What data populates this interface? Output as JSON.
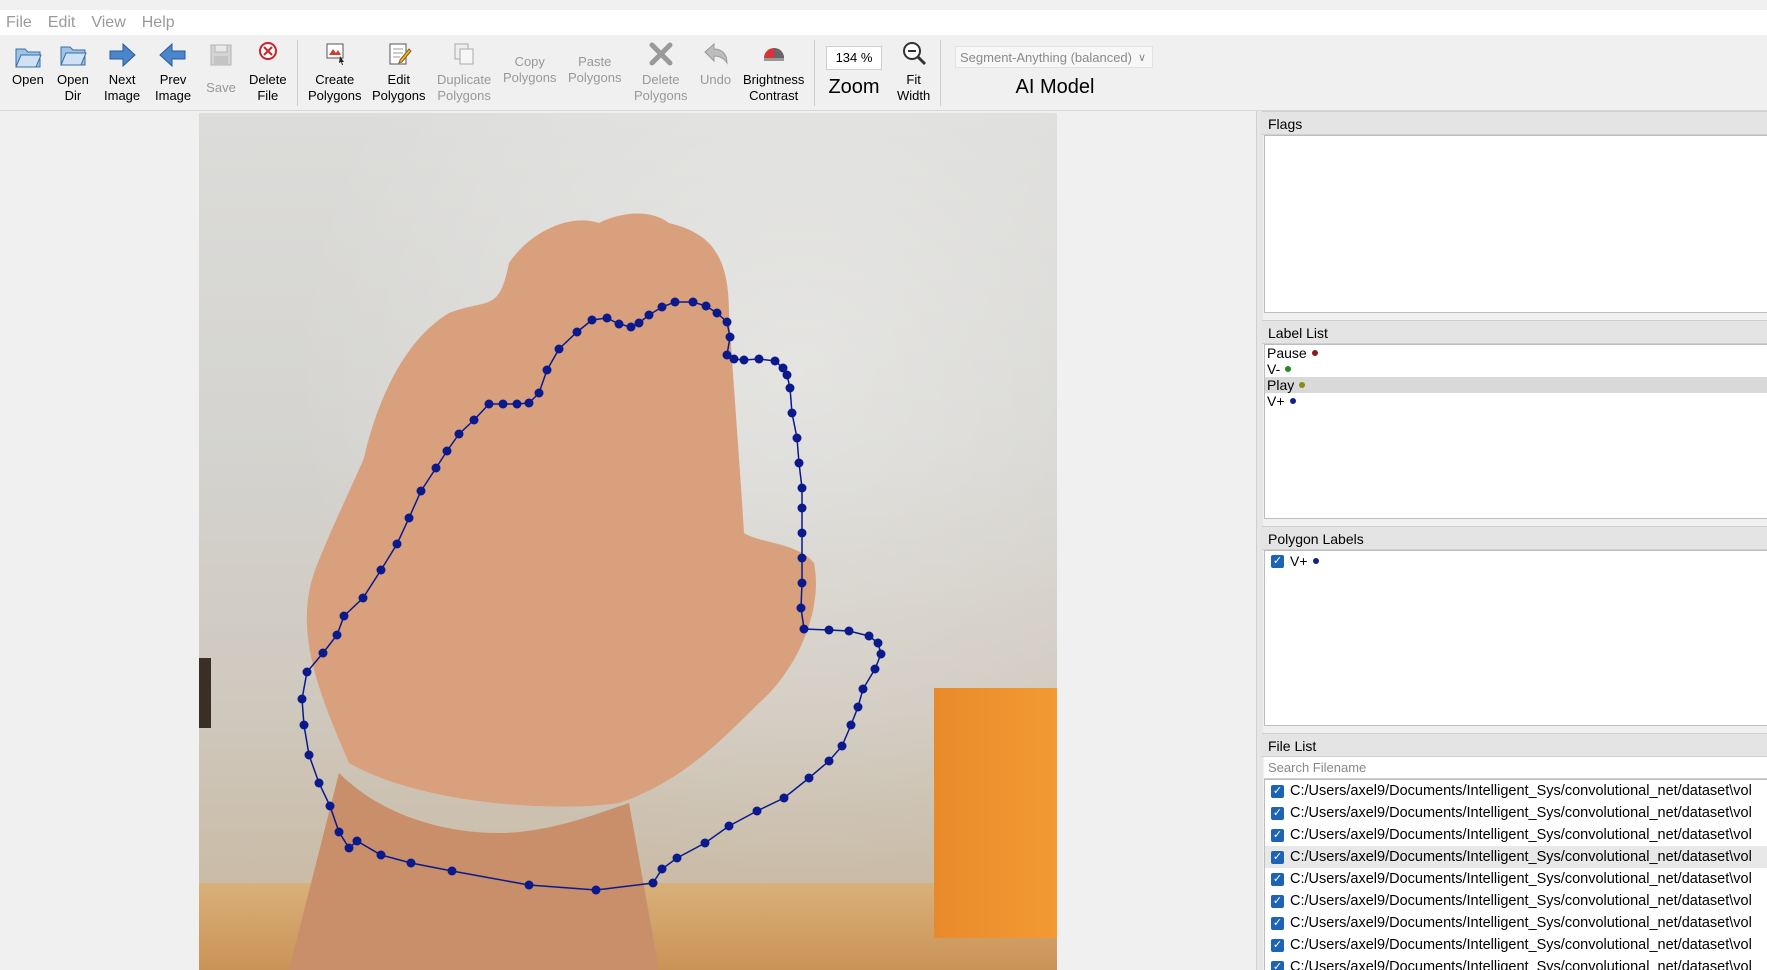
{
  "menu": [
    "File",
    "Edit",
    "View",
    "Help"
  ],
  "toolbar": {
    "open": "Open",
    "open_dir": "Open\nDir",
    "next_image": "Next\nImage",
    "prev_image": "Prev\nImage",
    "save": "Save",
    "delete_file": "Delete\nFile",
    "create_polygons": "Create\nPolygons",
    "edit_polygons": "Edit\nPolygons",
    "duplicate_polygons": "Duplicate\nPolygons",
    "copy_polygons": "Copy\nPolygons",
    "paste_polygons": "Paste\nPolygons",
    "delete_polygons": "Delete\nPolygons",
    "undo": "Undo",
    "brightness_contrast": "Brightness\nContrast",
    "zoom_value": "134 %",
    "zoom_label": "Zoom",
    "fit_width": "Fit\nWidth",
    "ai_model_value": "Segment-Anything (balanced)",
    "ai_model_label": "AI Model"
  },
  "colors": {
    "polygon": "#0a1a8c",
    "pause": "#8b1a1a",
    "v_minus": "#1f8a1f",
    "play": "#8a8a10",
    "v_plus": "#12208c"
  },
  "flags": {
    "title": "Flags"
  },
  "label_list": {
    "title": "Label List",
    "items": [
      {
        "name": "Pause",
        "color": "#8b1a1a"
      },
      {
        "name": "V-",
        "color": "#1f8a1f"
      },
      {
        "name": "Play",
        "color": "#8a8a10"
      },
      {
        "name": "V+",
        "color": "#12208c"
      }
    ],
    "selected_index": 2
  },
  "polygon_labels": {
    "title": "Polygon Labels",
    "items": [
      {
        "name": "V+",
        "checked": true,
        "color": "#12208c"
      }
    ]
  },
  "file_list": {
    "title": "File List",
    "search_placeholder": "Search Filename",
    "files": [
      "C:/Users/axel9/Documents/Intelligent_Sys/convolutional_net/dataset\\vol",
      "C:/Users/axel9/Documents/Intelligent_Sys/convolutional_net/dataset\\vol",
      "C:/Users/axel9/Documents/Intelligent_Sys/convolutional_net/dataset\\vol",
      "C:/Users/axel9/Documents/Intelligent_Sys/convolutional_net/dataset\\vol",
      "C:/Users/axel9/Documents/Intelligent_Sys/convolutional_net/dataset\\vol",
      "C:/Users/axel9/Documents/Intelligent_Sys/convolutional_net/dataset\\vol",
      "C:/Users/axel9/Documents/Intelligent_Sys/convolutional_net/dataset\\vol",
      "C:/Users/axel9/Documents/Intelligent_Sys/convolutional_net/dataset\\vol",
      "C:/Users/axel9/Documents/Intelligent_Sys/convolutional_net/dataset\\vol"
    ],
    "selected_index": 3
  }
}
